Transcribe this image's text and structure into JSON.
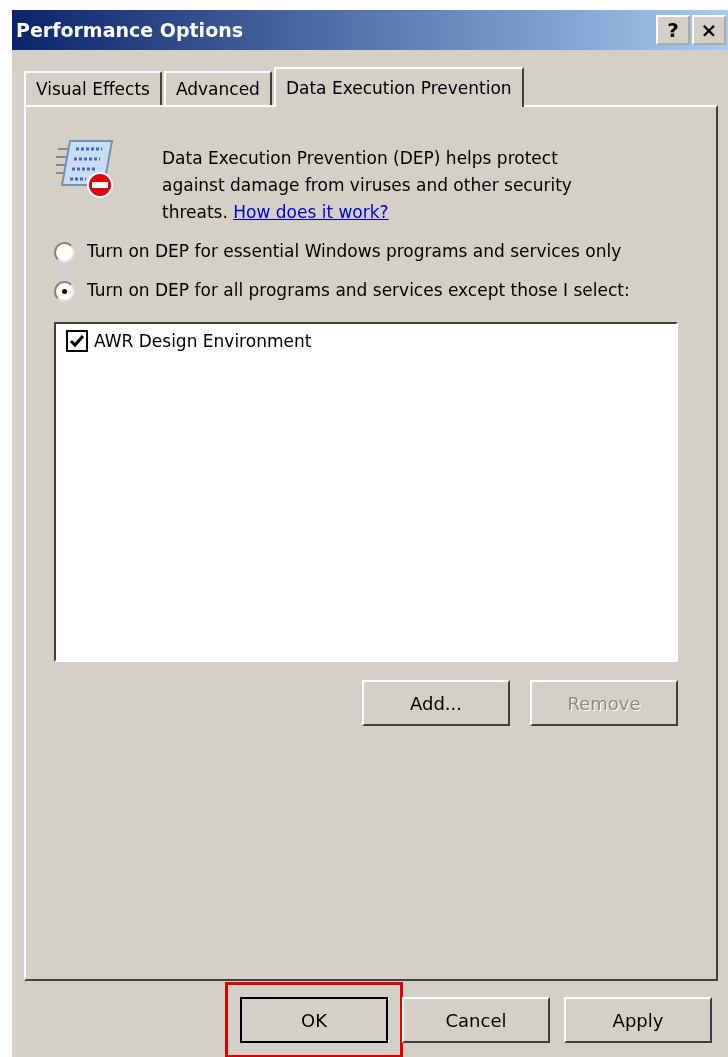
{
  "window": {
    "title": "Performance Options",
    "title_buttons": [
      "?",
      "×"
    ]
  },
  "tabs": [
    {
      "label": "Visual Effects",
      "selected": false
    },
    {
      "label": "Advanced",
      "selected": false
    },
    {
      "label": "Data Execution Prevention",
      "selected": true
    }
  ],
  "description": {
    "text": "Data Execution Prevention (DEP) helps protect against damage from viruses and other security threats.",
    "link": "How does it work?"
  },
  "options": [
    {
      "label": "Turn on DEP for essential Windows programs and services only",
      "selected": false
    },
    {
      "label": "Turn on DEP for all programs and services except those I select:",
      "selected": true
    }
  ],
  "program_list": [
    {
      "label": "AWR Design Environment",
      "checked": true
    }
  ],
  "list_buttons": [
    {
      "label": "Add...",
      "disabled": false
    },
    {
      "label": "Remove",
      "disabled": true
    }
  ],
  "buttons": [
    {
      "label": "OK",
      "highlighted": true
    },
    {
      "label": "Cancel",
      "highlighted": false
    },
    {
      "label": "Apply",
      "highlighted": false
    }
  ]
}
